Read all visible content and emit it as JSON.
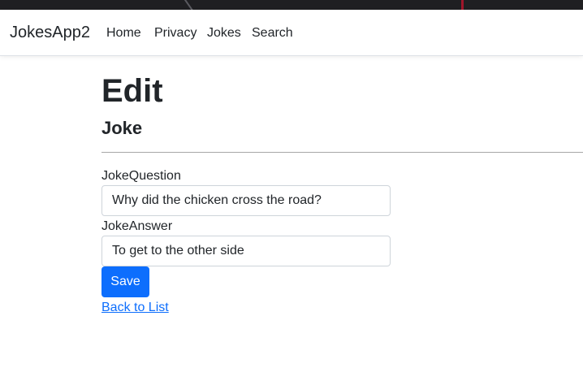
{
  "navbar": {
    "brand": "JokesApp2",
    "links": [
      "Home",
      "Privacy",
      "Jokes",
      "Search"
    ]
  },
  "page": {
    "title": "Edit",
    "subtitle": "Joke"
  },
  "form": {
    "question_label": "JokeQuestion",
    "question_value": "Why did the chicken cross the road?",
    "answer_label": "JokeAnswer",
    "answer_value": "To get to the other side",
    "save_label": "Save"
  },
  "back_link": "Back to List",
  "colors": {
    "primary": "#0d6efd",
    "text": "#212529",
    "border": "#ced4da"
  }
}
